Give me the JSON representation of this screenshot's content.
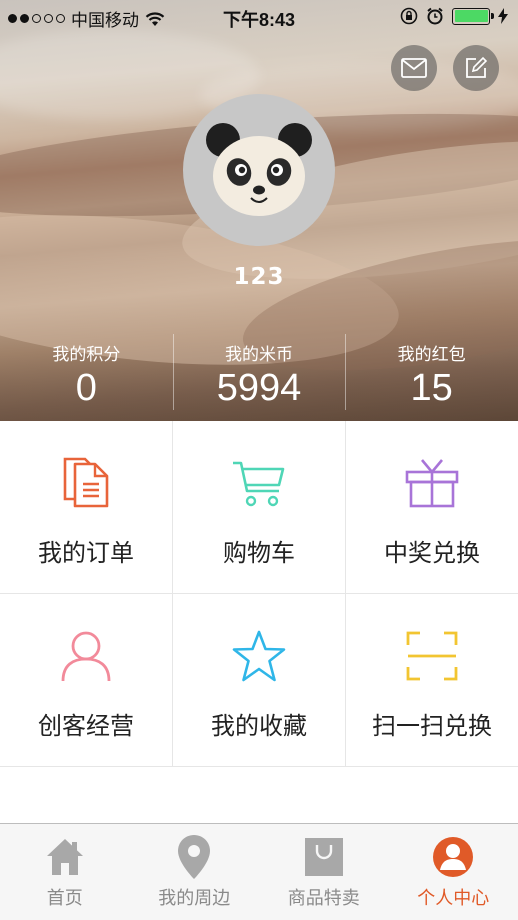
{
  "status_bar": {
    "carrier": "中国移动",
    "time": "下午8:43"
  },
  "profile": {
    "username": "123"
  },
  "stats": [
    {
      "label": "我的积分",
      "value": "0"
    },
    {
      "label": "我的米币",
      "value": "5994"
    },
    {
      "label": "我的红包",
      "value": "15"
    }
  ],
  "menu": [
    {
      "label": "我的订单",
      "icon": "document-icon",
      "color": "#e8643a"
    },
    {
      "label": "购物车",
      "icon": "cart-icon",
      "color": "#4fd6b6"
    },
    {
      "label": "中奖兑换",
      "icon": "gift-icon",
      "color": "#a874d8"
    },
    {
      "label": "创客经营",
      "icon": "person-icon",
      "color": "#f28a9a"
    },
    {
      "label": "我的收藏",
      "icon": "star-icon",
      "color": "#2fb6e8"
    },
    {
      "label": "扫一扫兑换",
      "icon": "scan-icon",
      "color": "#f2c531"
    }
  ],
  "tabs": [
    {
      "label": "首页",
      "icon": "home-icon",
      "active": false
    },
    {
      "label": "我的周边",
      "icon": "location-pin-icon",
      "active": false
    },
    {
      "label": "商品特卖",
      "icon": "shopping-bag-icon",
      "active": false
    },
    {
      "label": "个人中心",
      "icon": "user-icon",
      "active": true
    }
  ],
  "colors": {
    "accent": "#e05a28",
    "battery": "#4cd964",
    "tab_inactive": "#8a8a8a"
  }
}
